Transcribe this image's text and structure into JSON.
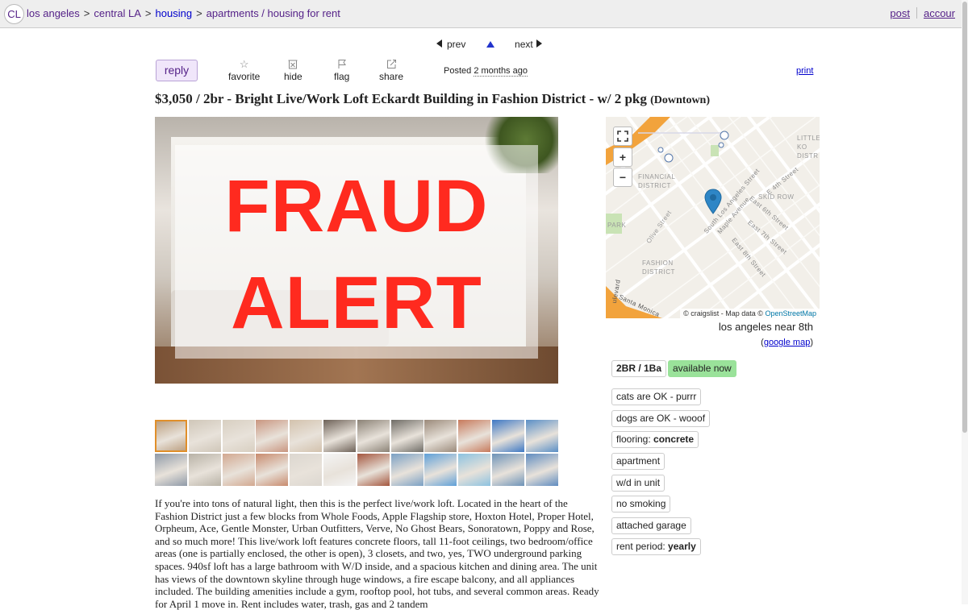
{
  "topbar": {
    "logo": "CL",
    "breadcrumbs": [
      {
        "label": "los angeles"
      },
      {
        "label": "central LA"
      },
      {
        "label": "housing"
      },
      {
        "label": "apartments / housing for rent"
      }
    ],
    "separator": ">",
    "post_label": "post",
    "account_label": "accour"
  },
  "nav": {
    "prev_label": "prev",
    "next_label": "next"
  },
  "actions": {
    "reply_label": "reply",
    "favorite_label": "favorite",
    "hide_label": "hide",
    "flag_label": "flag",
    "share_label": "share",
    "posted_prefix": "Posted",
    "posted_time": "2 months ago",
    "print_label": "print"
  },
  "listing": {
    "title": "$3,050 / 2br - Bright Live/Work Loft Eckardt Building in Fashion District - w/ 2 pkg",
    "neighborhood": "(Downtown)"
  },
  "photo": {
    "overlay_line1": "FRAUD",
    "overlay_line2": "ALERT"
  },
  "thumbnails": {
    "count": 24,
    "selected_index": 0,
    "colors": [
      "#b89a78",
      "#cfc6b8",
      "#d8cfc1",
      "#c99680",
      "#d3c2ad",
      "#6e6258",
      "#8b8276",
      "#6f6c66",
      "#9b8a7a",
      "#c77a5c",
      "#3e78c4",
      "#5a8fc6",
      "#8f9aa8",
      "#b8b2a6",
      "#d2a890",
      "#c88b6e",
      "#dcd7d0",
      "#f4f4f4",
      "#a4563e",
      "#7aa0c4",
      "#5fa0d8",
      "#8cc2e0",
      "#6d93b8",
      "#5f8cc0"
    ]
  },
  "description": {
    "text": "If you're into tons of natural light, then this is the perfect live/work loft. Located in the heart of the Fashion District just a few blocks from Whole Foods, Apple Flagship store, Hoxton Hotel, Proper Hotel, Orpheum, Ace, Gentle Monster, Urban Outfitters, Verve, No Ghost Bears, Sonoratown, Poppy and Rose, and so much more! This live/work loft features concrete floors, tall 11-foot ceilings, two bedroom/office areas (one is partially enclosed, the other is open), 3 closets, and two, yes, TWO underground parking spaces. 940sf loft has a large bathroom with W/D inside, and a spacious kitchen and dining area. The unit has views of the downtown skyline through huge windows, a fire escape balcony, and all appliances included. The building amenities include a gym, rooftop pool, hot tubs, and several common areas. Ready for April 1 move in. Rent includes water, trash, gas and 2 tandem"
  },
  "map": {
    "attribution_prefix": "© craigslist - Map data ©",
    "attribution_link": "OpenStreetMap",
    "labels": {
      "financial": "FINANCIAL",
      "district1": "DISTRICT",
      "skid_row": "SKID ROW",
      "park": "PARK",
      "fashion": "FASHION",
      "district2": "DISTRICT",
      "little": "LITTLE T",
      "ko": "KO",
      "distr": "DISTR",
      "olive": "Olive Street",
      "los_angeles_st": "South Los Angeles Street",
      "maple": "Maple Avenue",
      "e4th": "E 4th Street",
      "e6th": "East 6th Street",
      "e7th": "East 7th Street",
      "e8th": "East 8th Street",
      "santa_monica": "Santa Monica",
      "boulevard": "ulevard"
    },
    "location_text": "los angeles near 8th",
    "google_map_label": "google map"
  },
  "attributes": {
    "bedbath": "2BR / 1Ba",
    "availability": "available now",
    "tags": [
      {
        "label": "cats are OK - purrr",
        "value": ""
      },
      {
        "label": "dogs are OK - wooof",
        "value": ""
      },
      {
        "label": "flooring: ",
        "value": "concrete"
      },
      {
        "label": "apartment",
        "value": ""
      },
      {
        "label": "w/d in unit",
        "value": ""
      },
      {
        "label": "no smoking",
        "value": ""
      },
      {
        "label": "attached garage",
        "value": ""
      },
      {
        "label": "rent period: ",
        "value": "yearly"
      }
    ]
  }
}
